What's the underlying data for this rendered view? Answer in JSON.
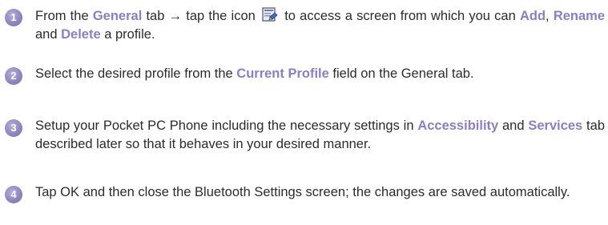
{
  "steps": [
    {
      "number": "1",
      "t1": "From the ",
      "h1": "General",
      "t2": " tab → tap the icon ",
      "icon": "profile-settings-icon",
      "t3": " to access a screen from which you can ",
      "h2": "Add",
      "t4": ", ",
      "h3": "Rename",
      "t5": " and ",
      "h4": "Delete",
      "t6": " a profile."
    },
    {
      "number": "2",
      "t1": "Select the desired profile from the ",
      "h1": "Current Profile",
      "t2": " field on the General tab."
    },
    {
      "number": "3",
      "t1": "Setup your Pocket PC Phone including the necessary settings in ",
      "h1": "Accessibility",
      "t2": " and ",
      "h2": "Services",
      "t3": " tab described later so that it behaves in your desired manner."
    },
    {
      "number": "4",
      "t1": "Tap OK and then close the Bluetooth Settings screen; the changes are saved automatically."
    }
  ]
}
